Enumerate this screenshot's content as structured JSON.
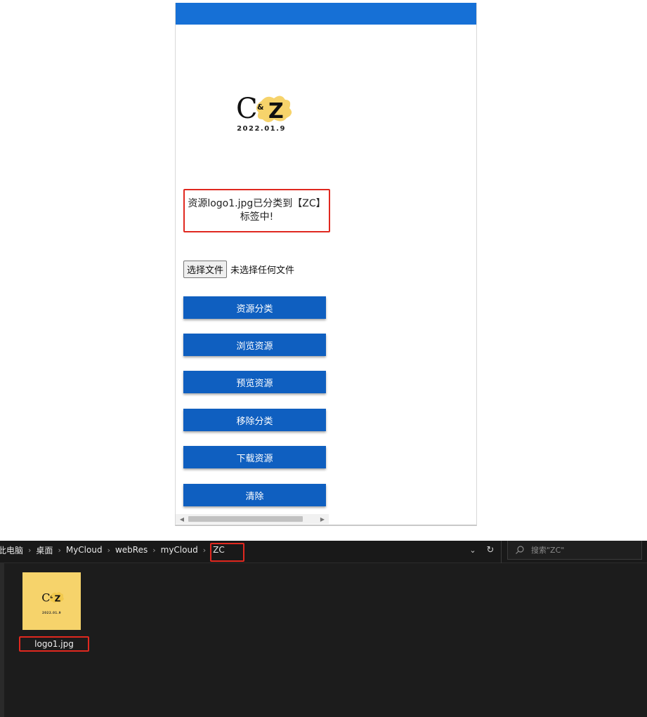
{
  "app": {
    "topbar_color": "#1670d6",
    "accent": "#0f5fc0",
    "highlight": "#e0281f"
  },
  "logo": {
    "text_c": "C",
    "text_amp": "&",
    "text_z": "Z",
    "date": "2022.01.9"
  },
  "message": {
    "text": "资源logo1.jpg已分类到【ZC】标签中!"
  },
  "file_input": {
    "button_label": "选择文件",
    "status": "未选择任何文件"
  },
  "actions": [
    {
      "label": "资源分类"
    },
    {
      "label": "浏览资源"
    },
    {
      "label": "预览资源"
    },
    {
      "label": "移除分类"
    },
    {
      "label": "下载资源"
    },
    {
      "label": "清除"
    }
  ],
  "explorer": {
    "breadcrumbs": [
      "此电脑",
      "桌面",
      "MyCloud",
      "webRes",
      "myCloud"
    ],
    "current_folder": "ZC",
    "search_placeholder": "搜索\"ZC\"",
    "files": [
      {
        "name": "logo1.jpg",
        "thumb_date": "2022.01.9"
      }
    ]
  }
}
